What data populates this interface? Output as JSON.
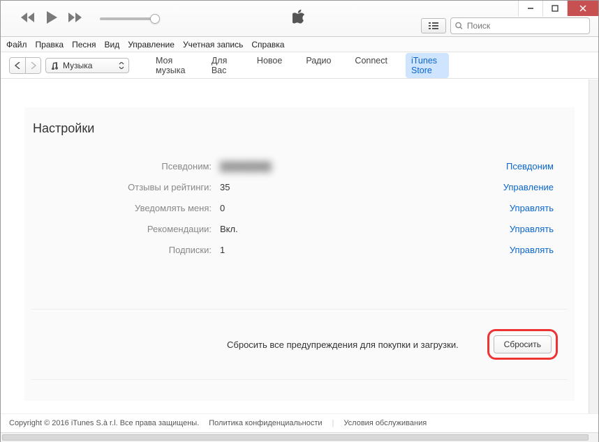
{
  "search": {
    "placeholder": "Поиск"
  },
  "menu": {
    "file": "Файл",
    "edit": "Правка",
    "song": "Песня",
    "view": "Вид",
    "controls": "Управление",
    "account": "Учетная запись",
    "help": "Справка"
  },
  "source": {
    "label": "Музыка"
  },
  "tabs": {
    "my_music": "Моя музыка",
    "for_you": "Для Вас",
    "new": "Новое",
    "radio": "Радио",
    "connect": "Connect",
    "store": "iTunes Store"
  },
  "page": {
    "title": "Настройки"
  },
  "settings": {
    "nickname": {
      "label": "Псевдоним:",
      "value": "████████",
      "link": "Псевдоним"
    },
    "reviews": {
      "label": "Отзывы и рейтинги:",
      "value": "35",
      "link": "Управление"
    },
    "notify": {
      "label": "Уведомлять меня:",
      "value": "0",
      "link": "Управлять"
    },
    "recs": {
      "label": "Рекомендации:",
      "value": "Вкл.",
      "link": "Управлять"
    },
    "subs": {
      "label": "Подписки:",
      "value": "1",
      "link": "Управлять"
    }
  },
  "reset": {
    "text": "Сбросить все предупреждения для покупки и загрузки.",
    "button": "Сбросить"
  },
  "footer": {
    "copyright": "Copyright © 2016 iTunes S.à r.l. Все права защищены.",
    "privacy": "Политика конфиденциальности",
    "terms": "Условия обслуживания"
  }
}
